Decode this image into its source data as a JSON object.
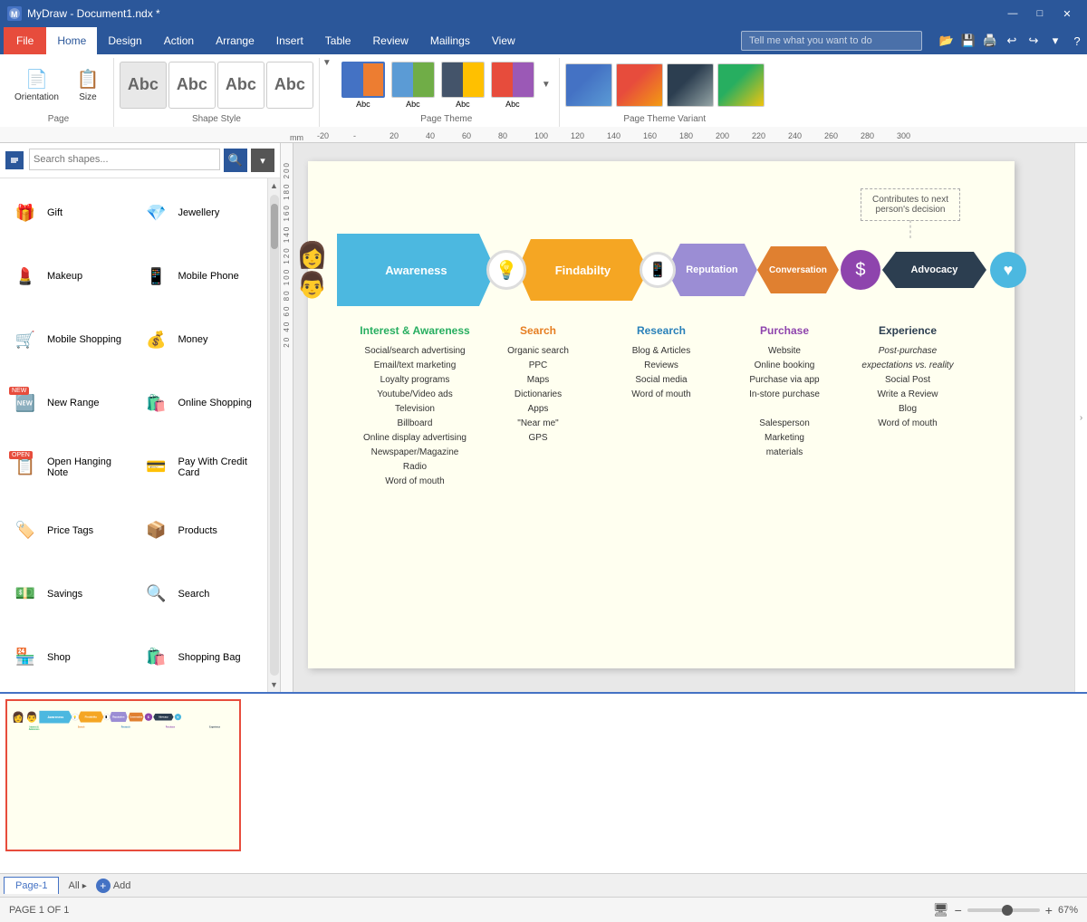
{
  "window": {
    "title": "MyDraw - Document1.ndx *",
    "icon": "M"
  },
  "window_controls": {
    "minimize": "—",
    "maximize": "□",
    "close": "✕"
  },
  "tabs": {
    "file": "File",
    "home": "Home",
    "design": "Design",
    "action": "Action",
    "arrange": "Arrange",
    "insert": "Insert",
    "table": "Table",
    "review": "Review",
    "mailings": "Mailings",
    "view": "View"
  },
  "search_placeholder": "Tell me what you want to do",
  "ribbon": {
    "page_group": "Page",
    "shape_style_group": "Shape Style",
    "page_theme_group": "Page Theme",
    "page_theme_variant_group": "Page Theme Variant",
    "orientation_label": "Orientation",
    "size_label": "Size",
    "abc_labels": [
      "Abc",
      "Abc",
      "Abc",
      "Abc"
    ]
  },
  "sidebar": {
    "search_placeholder": "Search shapes...",
    "items": [
      {
        "id": "gift",
        "label": "Gift",
        "icon": "🎁"
      },
      {
        "id": "jewellery",
        "label": "Jewellery",
        "icon": "💎"
      },
      {
        "id": "makeup",
        "label": "Makeup",
        "icon": "💄"
      },
      {
        "id": "mobile-phone",
        "label": "Mobile Phone",
        "icon": "📱"
      },
      {
        "id": "mobile-shopping",
        "label": "Mobile Shopping",
        "icon": "🛒"
      },
      {
        "id": "money",
        "label": "Money",
        "icon": "💰"
      },
      {
        "id": "new-range",
        "label": "New Range",
        "icon": "🆕",
        "badge": "NEW"
      },
      {
        "id": "online-shopping",
        "label": "Online Shopping",
        "icon": "🛍️"
      },
      {
        "id": "open-hanging-note",
        "label": "Open Hanging Note",
        "icon": "📋",
        "badge": "OPEN"
      },
      {
        "id": "pay-with-credit-card",
        "label": "Pay With Credit Card",
        "icon": "💳"
      },
      {
        "id": "price-tags",
        "label": "Price Tags",
        "icon": "🏷️"
      },
      {
        "id": "products",
        "label": "Products",
        "icon": "📦"
      },
      {
        "id": "savings",
        "label": "Savings",
        "icon": "💵"
      },
      {
        "id": "search",
        "label": "Search",
        "icon": "🔍"
      },
      {
        "id": "shop",
        "label": "Shop",
        "icon": "🏪"
      },
      {
        "id": "shopping-bag",
        "label": "Shopping Bag",
        "icon": "🛍️"
      }
    ]
  },
  "diagram": {
    "annotation": {
      "line1": "Contributes to next",
      "line2": "person's decision"
    },
    "segments": [
      {
        "id": "awareness",
        "label": "Awareness",
        "color": "#4cb8e0"
      },
      {
        "id": "findability",
        "label": "Findabilty",
        "color": "#f5a623"
      },
      {
        "id": "reputation",
        "label": "Reputation",
        "color": "#9b8dd4"
      },
      {
        "id": "conversation",
        "label": "Conversation",
        "color": "#e08030"
      },
      {
        "id": "advocacy",
        "label": "Advocacy",
        "color": "#2c3e50"
      }
    ],
    "categories": [
      {
        "id": "interest",
        "title": "Interest & Awareness",
        "color": "#27ae60",
        "items": [
          "Social/search advertising",
          "Email/text marketing",
          "Loyalty programs",
          "Youtube/Video ads",
          "Television",
          "Billboard",
          "Online display advertising",
          "Newspaper/Magazine",
          "Radio",
          "Word of mouth"
        ]
      },
      {
        "id": "search",
        "title": "Search",
        "color": "#e67e22",
        "items": [
          "Organic search",
          "PPC",
          "Maps",
          "Dictionaries",
          "Apps",
          "\"Near me\"",
          "GPS"
        ]
      },
      {
        "id": "research",
        "title": "Research",
        "color": "#2980b9",
        "items": [
          "Blog & Articles",
          "Reviews",
          "Social media",
          "Word of mouth"
        ]
      },
      {
        "id": "purchase",
        "title": "Purchase",
        "color": "#8e44ad",
        "items": [
          "Website",
          "Online booking",
          "Purchase via app",
          "In-store purchase",
          "",
          "Salesperson",
          "Marketing",
          "materials"
        ]
      },
      {
        "id": "experience",
        "title": "Experience",
        "color": "#2c3e50",
        "items": [
          "Post-purchase",
          "expectations vs. reality",
          "Social Post",
          "Write a Review",
          "Blog",
          "Word of mouth"
        ]
      }
    ]
  },
  "page_tabs": {
    "current": "Page-1",
    "all_label": "All",
    "add_label": "Add"
  },
  "footer": {
    "page_indicator": "PAGE 1 OF 1",
    "zoom_level": "67%"
  },
  "qat_buttons": [
    "💾",
    "↩",
    "↪"
  ],
  "theme_colors": {
    "t1a": "#4472c4",
    "t1b": "#70ad47",
    "t1c": "#ffc000",
    "t2a": "#5b9bd5",
    "t2b": "#ed7d31",
    "t2c": "#a5a5a5",
    "t3a": "#44546a",
    "t3b": "#e2efda",
    "t3c": "#fce4d6",
    "t4a": "#c55a11",
    "t4b": "#bf8f00",
    "t4c": "#375623"
  }
}
